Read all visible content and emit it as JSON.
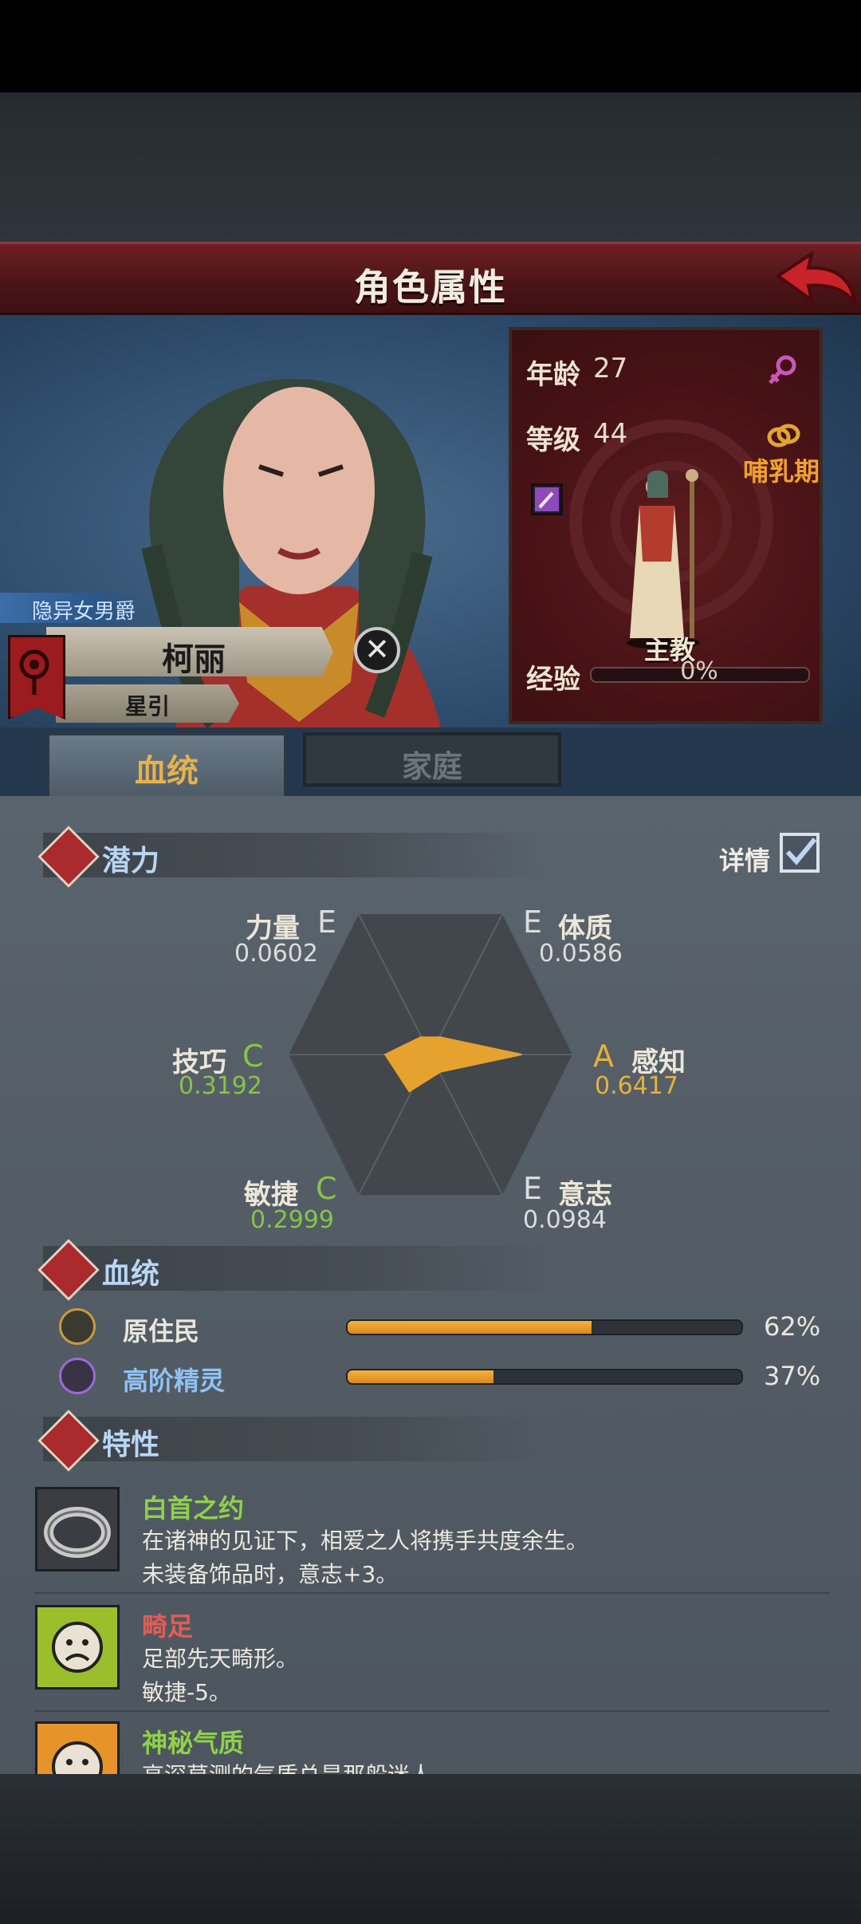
{
  "header": {
    "title": "角色属性",
    "back_icon": "back-arrow-icon"
  },
  "character": {
    "title_tag": "隐异女男爵",
    "name": "柯丽",
    "sub_name": "星引"
  },
  "stats": {
    "age_label": "年龄",
    "age_value": "27",
    "level_label": "等级",
    "level_value": "44",
    "stage": "哺乳期",
    "class_name": "主教",
    "exp_label": "经验",
    "exp_value": "0%",
    "exp_fraction": 0.0,
    "gender_icon": "female-symbol-icon",
    "ring_icon": "wedding-ring-icon",
    "weapon_icon": "staff-icon"
  },
  "tabs": [
    {
      "label": "血统",
      "active": true
    },
    {
      "label": "家庭",
      "active": false
    }
  ],
  "potential": {
    "title": "潜力",
    "detail_label": "详情",
    "detail_checked": true,
    "attributes": [
      {
        "name": "力量",
        "grade": "E",
        "value": "0.0602",
        "fraction": 0.0602
      },
      {
        "name": "体质",
        "grade": "E",
        "value": "0.0586",
        "fraction": 0.0586
      },
      {
        "name": "感知",
        "grade": "A",
        "value": "0.6417",
        "fraction": 0.6417
      },
      {
        "name": "意志",
        "grade": "E",
        "value": "0.0984",
        "fraction": 0.0984
      },
      {
        "name": "敏捷",
        "grade": "C",
        "value": "0.2999",
        "fraction": 0.2999
      },
      {
        "name": "技巧",
        "grade": "C",
        "value": "0.3192",
        "fraction": 0.3192
      }
    ]
  },
  "lineage": {
    "title": "血统",
    "items": [
      {
        "name": "原住民",
        "percent_text": "62%",
        "fraction": 0.62,
        "color": "#e9e6df",
        "icon": "leaf-emblem-icon"
      },
      {
        "name": "高阶精灵",
        "percent_text": "37%",
        "fraction": 0.37,
        "color": "#8fc2f2",
        "icon": "elf-emblem-icon"
      }
    ]
  },
  "traits": {
    "title": "特性",
    "items": [
      {
        "name": "白首之约",
        "color": "#8fd14a",
        "lines": [
          "在诸神的见证下，相爱之人将携手共度余生。",
          "未装备饰品时，意志+3。"
        ],
        "icon": "ring-icon"
      },
      {
        "name": "畸足",
        "color": "#e45c55",
        "lines": [
          "足部先天畸形。",
          "敏捷-5。"
        ],
        "icon": "sad-face-icon"
      },
      {
        "name": "神秘气质",
        "color": "#8fd14a",
        "lines": [
          "高深莫测的气质总是那般迷人。"
        ],
        "icon": "sun-face-icon"
      }
    ]
  },
  "colors": {
    "grade_E": "#dcdcdc",
    "grade_C": "#86c44a",
    "grade_A": "#e6b23a",
    "radar_fill": "#e6a22e",
    "accent_red": "#ab2a2e"
  }
}
